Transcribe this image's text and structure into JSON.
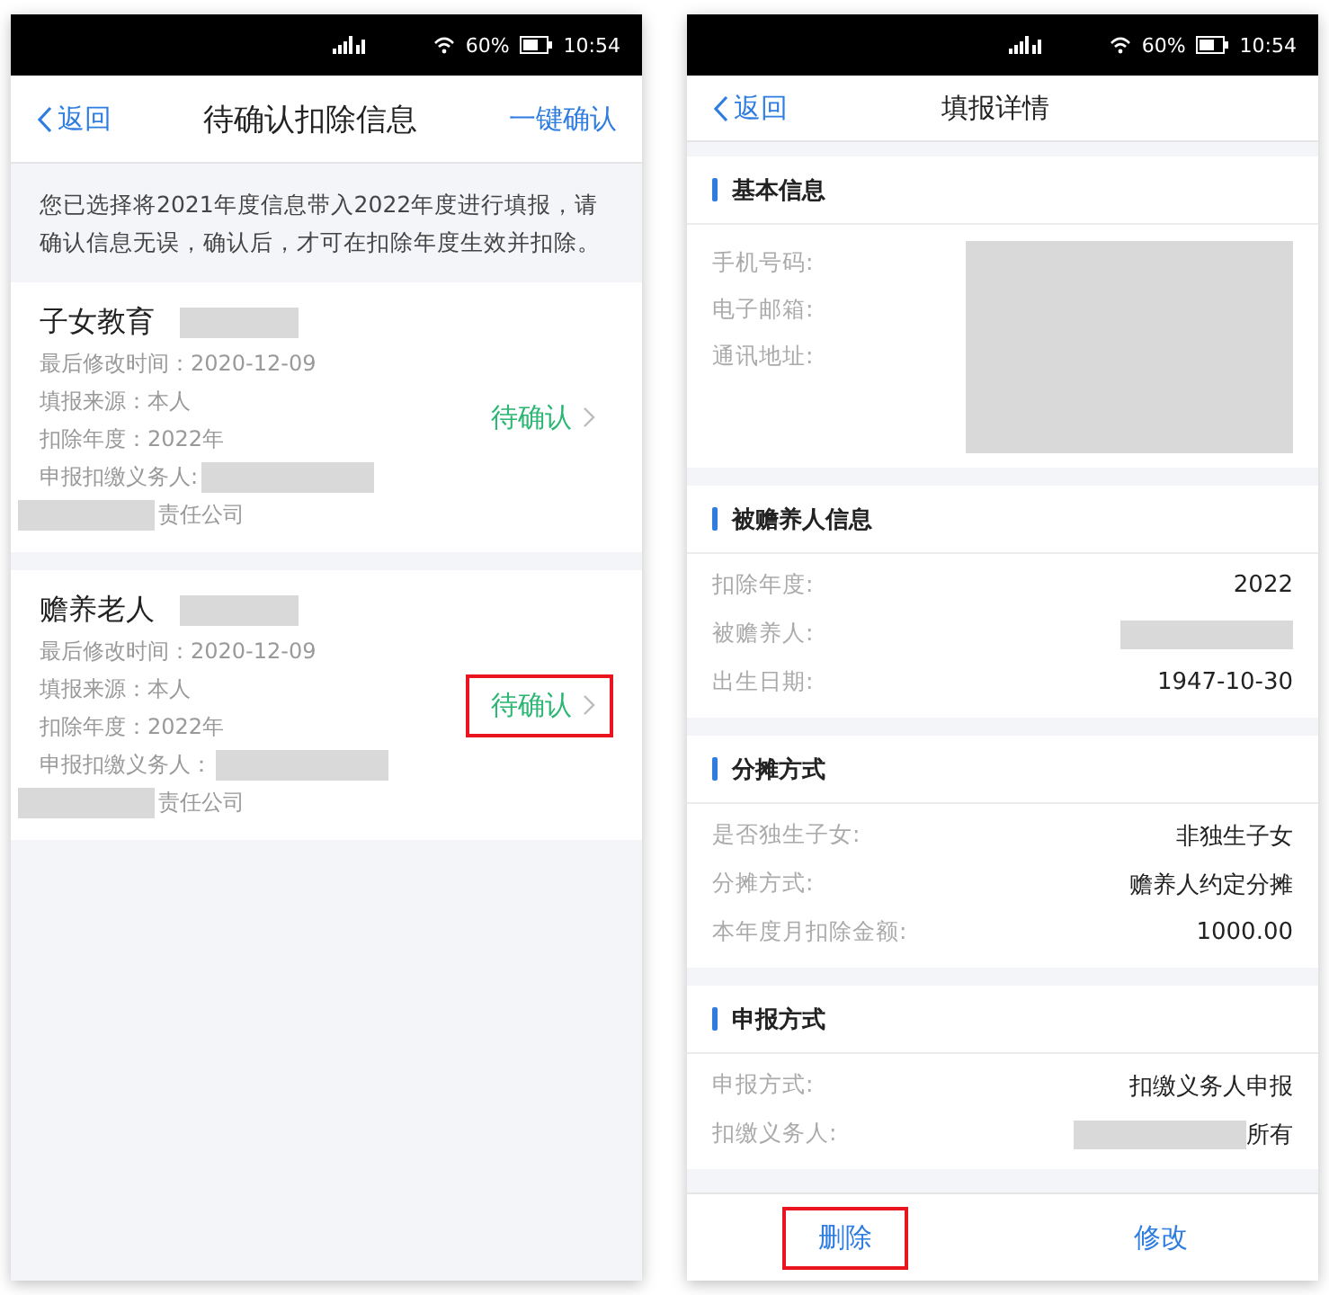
{
  "left_screen": {
    "status_bar": {
      "battery": "60%",
      "time": "10:54"
    },
    "nav": {
      "back": "返回",
      "title": "待确认扣除信息",
      "action": "一键确认"
    },
    "notice": "您已选择将2021年度信息带入2022年度进行填报，请确认信息无误，确认后，才可在扣除年度生效并扣除。",
    "cards": [
      {
        "title": "子女教育",
        "lines": [
          "最后修改时间：2020-12-09",
          "填报来源：本人",
          "扣除年度：2022年"
        ],
        "agent_label": "申报扣缴义务人:",
        "company_suffix": "责任公司",
        "status": "待确认",
        "highlighted": false
      },
      {
        "title": "赡养老人",
        "lines": [
          "最后修改时间：2020-12-09",
          "填报来源：本人",
          "扣除年度：2022年"
        ],
        "agent_label": "申报扣缴义务人：",
        "company_suffix": "责任公司",
        "status": "待确认",
        "highlighted": true
      }
    ]
  },
  "right_screen": {
    "status_bar": {
      "battery": "60%",
      "time": "10:54"
    },
    "nav": {
      "back": "返回",
      "title": "填报详情"
    },
    "sections": [
      {
        "title": "基本信息",
        "kind": "block",
        "rows": [
          {
            "label": "手机号码:"
          },
          {
            "label": "电子邮箱:"
          },
          {
            "label": "通讯地址:"
          }
        ]
      },
      {
        "title": "被赡养人信息",
        "kind": "rows",
        "rows": [
          {
            "label": "扣除年度:",
            "value": "2022"
          },
          {
            "label": "被赡养人:",
            "redacted": true
          },
          {
            "label": "出生日期:",
            "value": "1947-10-30"
          }
        ]
      },
      {
        "title": "分摊方式",
        "kind": "rows",
        "rows": [
          {
            "label": "是否独生子女:",
            "value": "非独生子女"
          },
          {
            "label": "分摊方式:",
            "value": "赡养人约定分摊"
          },
          {
            "label": "本年度月扣除金额:",
            "value": "1000.00"
          }
        ]
      },
      {
        "title": "申报方式",
        "kind": "rows",
        "rows": [
          {
            "label": "申报方式:",
            "value": "扣缴义务人申报"
          },
          {
            "label": "扣缴义务人:",
            "redacted": true,
            "value": "所有"
          }
        ]
      }
    ],
    "buttons": [
      {
        "label": "删除",
        "highlighted": true
      },
      {
        "label": "修改",
        "highlighted": false
      }
    ]
  }
}
